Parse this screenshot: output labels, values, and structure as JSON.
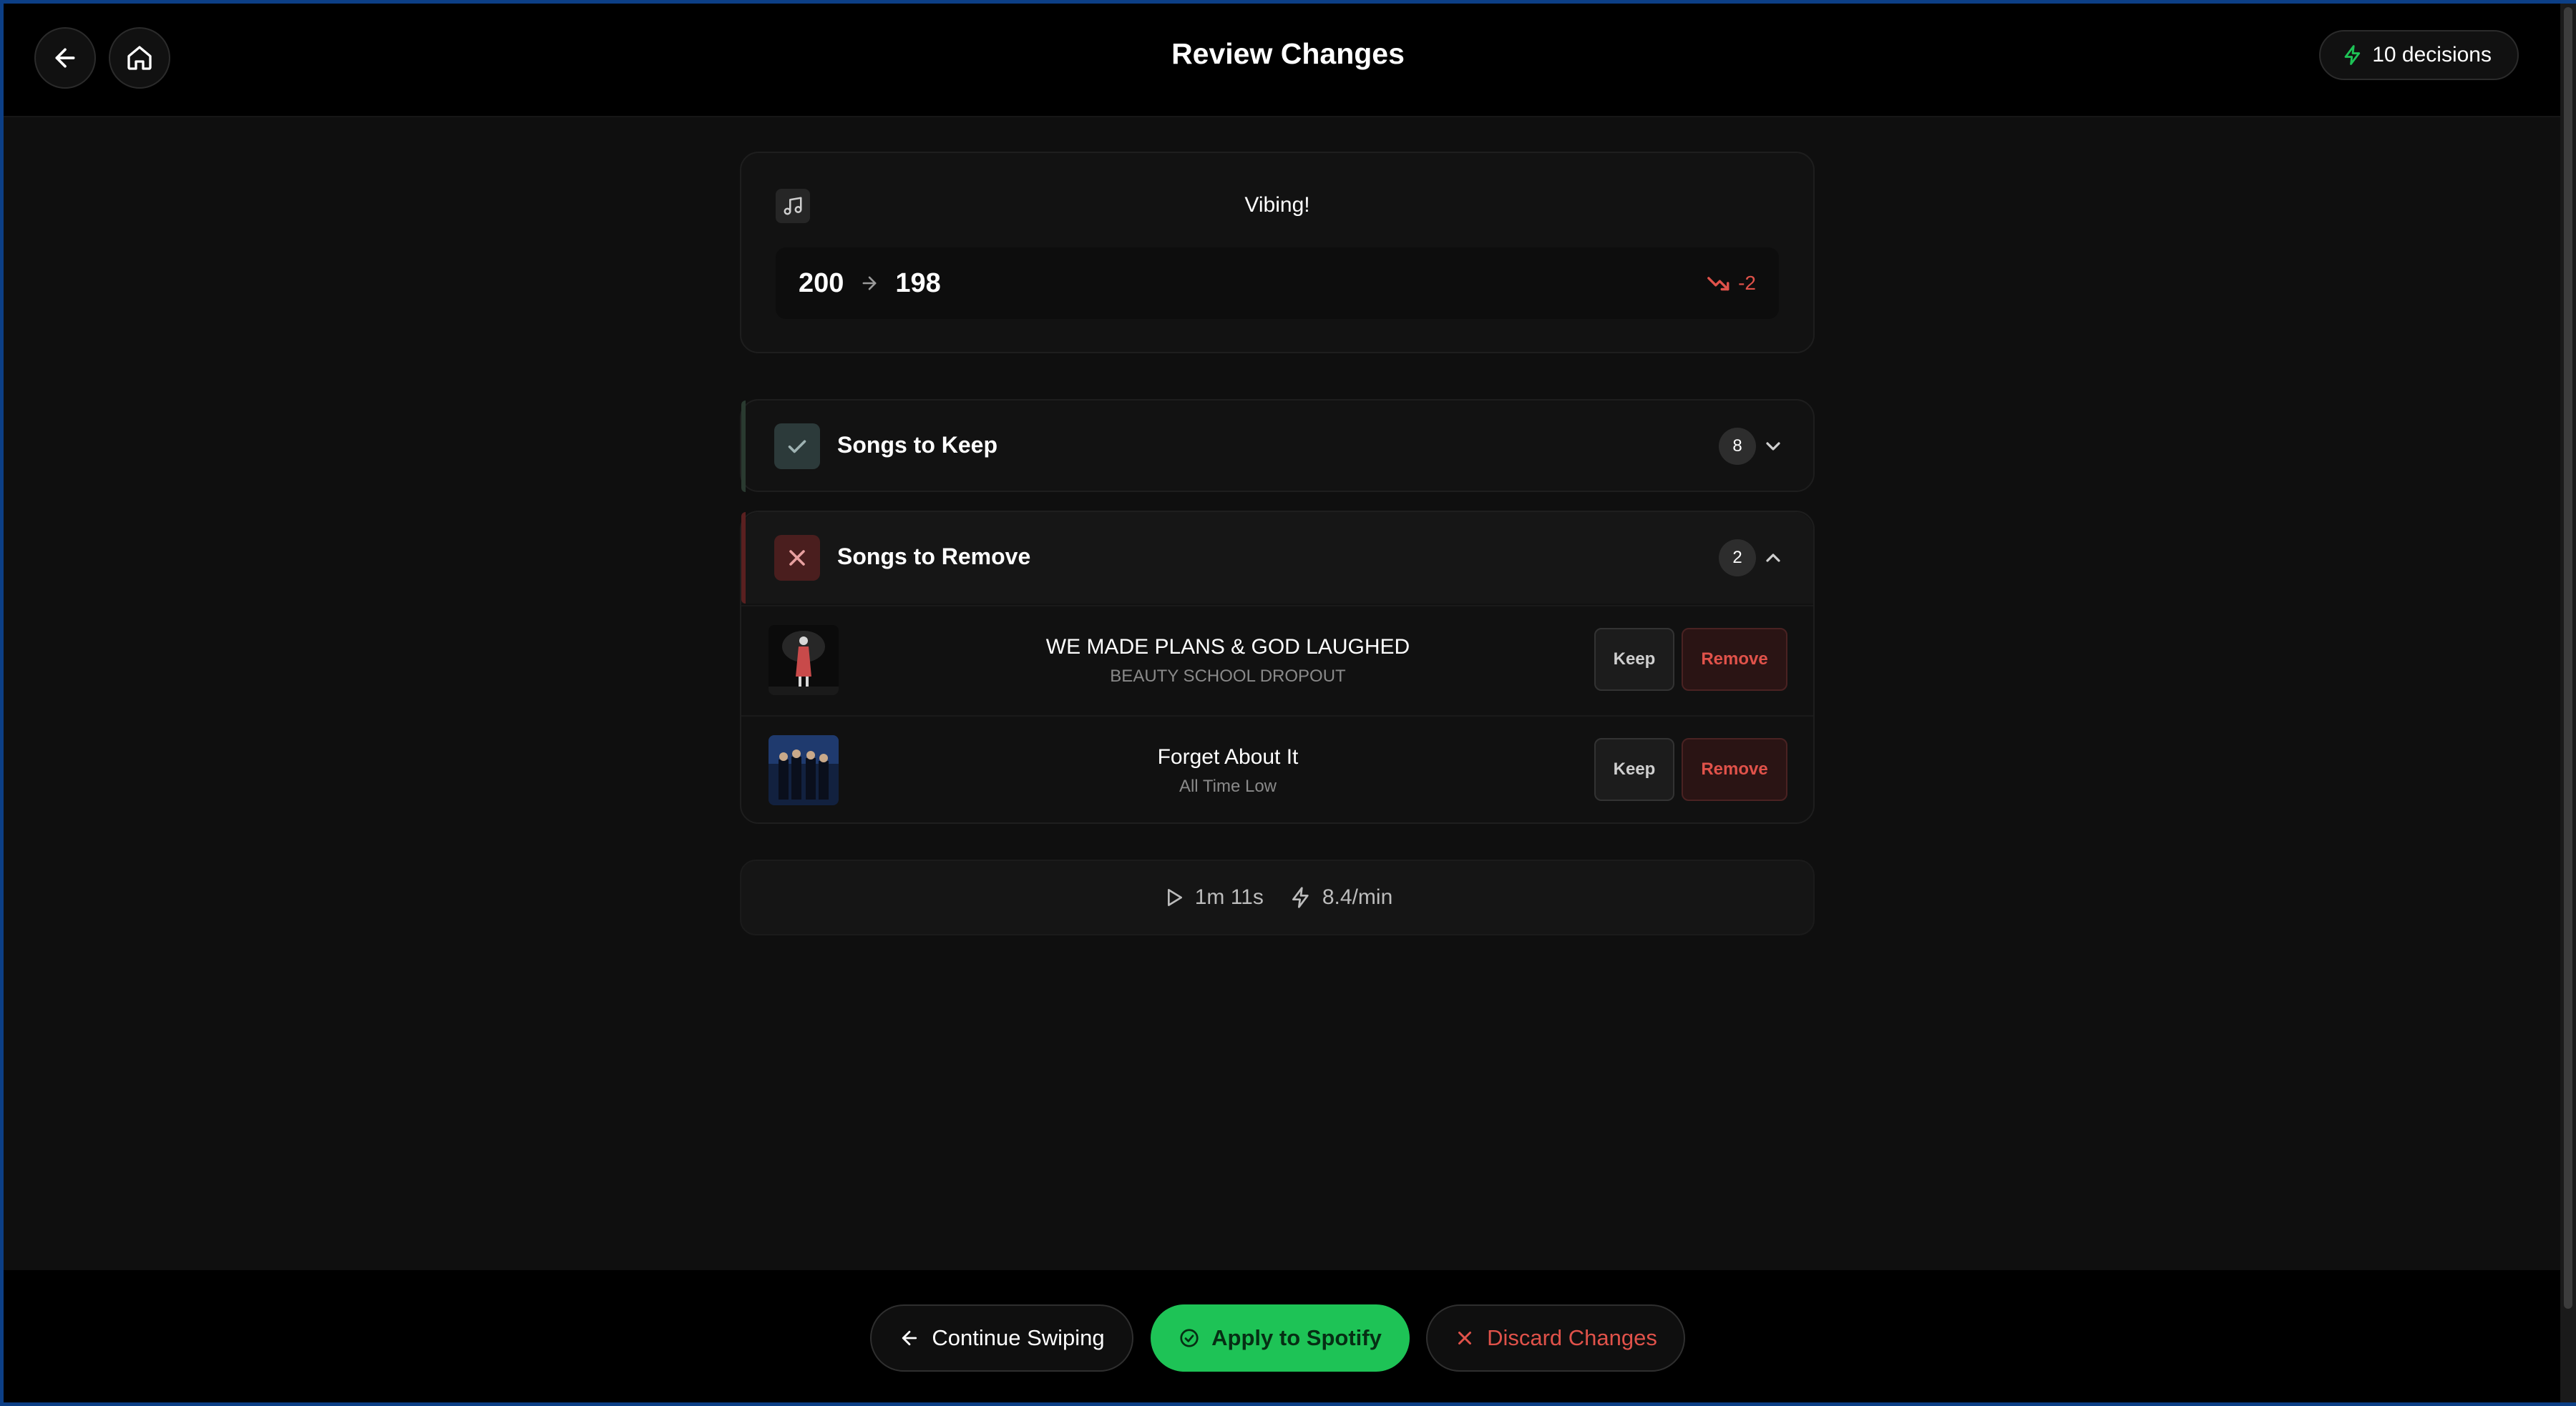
{
  "header": {
    "title": "Review Changes",
    "decisions_label": "10 decisions"
  },
  "playlist": {
    "name": "Vibing!",
    "count_before": "200",
    "count_after": "198",
    "delta": "-2"
  },
  "sections": {
    "keep": {
      "label": "Songs to Keep",
      "count": "8",
      "expanded": false
    },
    "remove": {
      "label": "Songs to Remove",
      "count": "2",
      "expanded": true
    }
  },
  "remove_songs": [
    {
      "title": "WE MADE PLANS & GOD LAUGHED",
      "artist": "BEAUTY SCHOOL DROPOUT",
      "keep_label": "Keep",
      "remove_label": "Remove"
    },
    {
      "title": "Forget About It",
      "artist": "All Time Low",
      "keep_label": "Keep",
      "remove_label": "Remove"
    }
  ],
  "stats": {
    "duration": "1m 11s",
    "rate": "8.4/min"
  },
  "footer": {
    "continue_label": "Continue Swiping",
    "apply_label": "Apply to Spotify",
    "discard_label": "Discard Changes"
  },
  "colors": {
    "accent_green": "#1ec356",
    "danger_red": "#e0524a",
    "background": "#0f0f0f"
  }
}
